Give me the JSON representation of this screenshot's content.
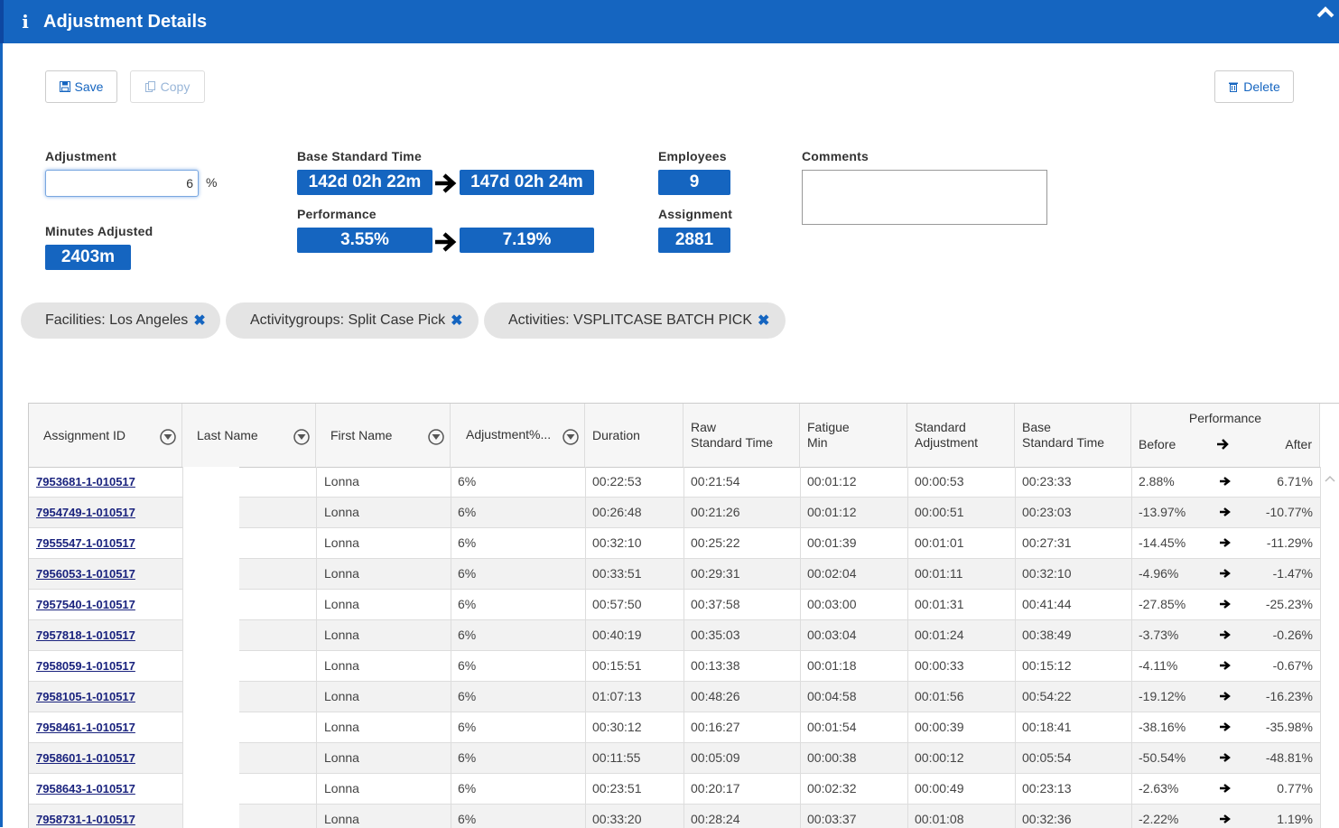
{
  "header": {
    "title": "Adjustment Details"
  },
  "toolbar": {
    "save_label": "Save",
    "copy_label": "Copy",
    "delete_label": "Delete"
  },
  "adjustment": {
    "label": "Adjustment",
    "value": "6",
    "unit": "%"
  },
  "minutes_adjusted": {
    "label": "Minutes Adjusted",
    "value": "2403m"
  },
  "base_standard_time": {
    "label": "Base Standard Time",
    "before": "142d 02h 22m",
    "after": "147d 02h 24m"
  },
  "performance": {
    "label": "Performance",
    "before": "3.55%",
    "after": "7.19%"
  },
  "employees": {
    "label": "Employees",
    "value": "9"
  },
  "assignment": {
    "label": "Assignment",
    "value": "2881"
  },
  "comments": {
    "label": "Comments",
    "value": ""
  },
  "filters": [
    {
      "label": "Facilities: Los Angeles"
    },
    {
      "label": "Activitygroups: Split Case Pick"
    },
    {
      "label": "Activities: VSPLITCASE BATCH PICK"
    }
  ],
  "table": {
    "columns": {
      "assignment_id": "Assignment ID",
      "last_name": "Last Name",
      "first_name": "First Name",
      "adjustment_pct": "Adjustment%...",
      "duration": "Duration",
      "raw_standard_time_1": "Raw",
      "raw_standard_time_2": "Standard Time",
      "fatigue_min_1": "Fatigue",
      "fatigue_min_2": "Min",
      "standard_adjustment_1": "Standard",
      "standard_adjustment_2": "Adjustment",
      "base_standard_time_1": "Base",
      "base_standard_time_2": "Standard Time",
      "performance": "Performance",
      "before": "Before",
      "after": "After"
    },
    "rows": [
      {
        "id": "7953681-1-010517",
        "first": "Lonna",
        "adj": "6%",
        "duration": "00:22:53",
        "raw": "00:21:54",
        "fatigue": "00:01:12",
        "std_adj": "00:00:53",
        "base": "00:23:33",
        "before": "2.88%",
        "after": "6.71%"
      },
      {
        "id": "7954749-1-010517",
        "first": "Lonna",
        "adj": "6%",
        "duration": "00:26:48",
        "raw": "00:21:26",
        "fatigue": "00:01:12",
        "std_adj": "00:00:51",
        "base": "00:23:03",
        "before": "-13.97%",
        "after": "-10.77%"
      },
      {
        "id": "7955547-1-010517",
        "first": "Lonna",
        "adj": "6%",
        "duration": "00:32:10",
        "raw": "00:25:22",
        "fatigue": "00:01:39",
        "std_adj": "00:01:01",
        "base": "00:27:31",
        "before": "-14.45%",
        "after": "-11.29%"
      },
      {
        "id": "7956053-1-010517",
        "first": "Lonna",
        "adj": "6%",
        "duration": "00:33:51",
        "raw": "00:29:31",
        "fatigue": "00:02:04",
        "std_adj": "00:01:11",
        "base": "00:32:10",
        "before": "-4.96%",
        "after": "-1.47%"
      },
      {
        "id": "7957540-1-010517",
        "first": "Lonna",
        "adj": "6%",
        "duration": "00:57:50",
        "raw": "00:37:58",
        "fatigue": "00:03:00",
        "std_adj": "00:01:31",
        "base": "00:41:44",
        "before": "-27.85%",
        "after": "-25.23%"
      },
      {
        "id": "7957818-1-010517",
        "first": "Lonna",
        "adj": "6%",
        "duration": "00:40:19",
        "raw": "00:35:03",
        "fatigue": "00:03:04",
        "std_adj": "00:01:24",
        "base": "00:38:49",
        "before": "-3.73%",
        "after": "-0.26%"
      },
      {
        "id": "7958059-1-010517",
        "first": "Lonna",
        "adj": "6%",
        "duration": "00:15:51",
        "raw": "00:13:38",
        "fatigue": "00:01:18",
        "std_adj": "00:00:33",
        "base": "00:15:12",
        "before": "-4.11%",
        "after": "-0.67%"
      },
      {
        "id": "7958105-1-010517",
        "first": "Lonna",
        "adj": "6%",
        "duration": "01:07:13",
        "raw": "00:48:26",
        "fatigue": "00:04:58",
        "std_adj": "00:01:56",
        "base": "00:54:22",
        "before": "-19.12%",
        "after": "-16.23%"
      },
      {
        "id": "7958461-1-010517",
        "first": "Lonna",
        "adj": "6%",
        "duration": "00:30:12",
        "raw": "00:16:27",
        "fatigue": "00:01:54",
        "std_adj": "00:00:39",
        "base": "00:18:41",
        "before": "-38.16%",
        "after": "-35.98%"
      },
      {
        "id": "7958601-1-010517",
        "first": "Lonna",
        "adj": "6%",
        "duration": "00:11:55",
        "raw": "00:05:09",
        "fatigue": "00:00:38",
        "std_adj": "00:00:12",
        "base": "00:05:54",
        "before": "-50.54%",
        "after": "-48.81%"
      },
      {
        "id": "7958643-1-010517",
        "first": "Lonna",
        "adj": "6%",
        "duration": "00:23:51",
        "raw": "00:20:17",
        "fatigue": "00:02:32",
        "std_adj": "00:00:49",
        "base": "00:23:13",
        "before": "-2.63%",
        "after": "0.77%"
      },
      {
        "id": "7958731-1-010517",
        "first": "Lonna",
        "adj": "6%",
        "duration": "00:33:20",
        "raw": "00:28:24",
        "fatigue": "00:03:37",
        "std_adj": "00:01:08",
        "base": "00:32:36",
        "before": "-2.22%",
        "after": "1.19%"
      }
    ]
  },
  "colors": {
    "brand": "#1565c0",
    "link": "#1a237e",
    "chip_bg": "#e4e4e4"
  },
  "icons": {
    "info": "info-icon",
    "collapse": "chevron-up-icon",
    "save": "floppy-icon",
    "copy": "copy-icon",
    "delete": "trash-icon",
    "filter": "filter-icon",
    "arrow": "arrow-right-icon",
    "remove": "close-icon"
  }
}
